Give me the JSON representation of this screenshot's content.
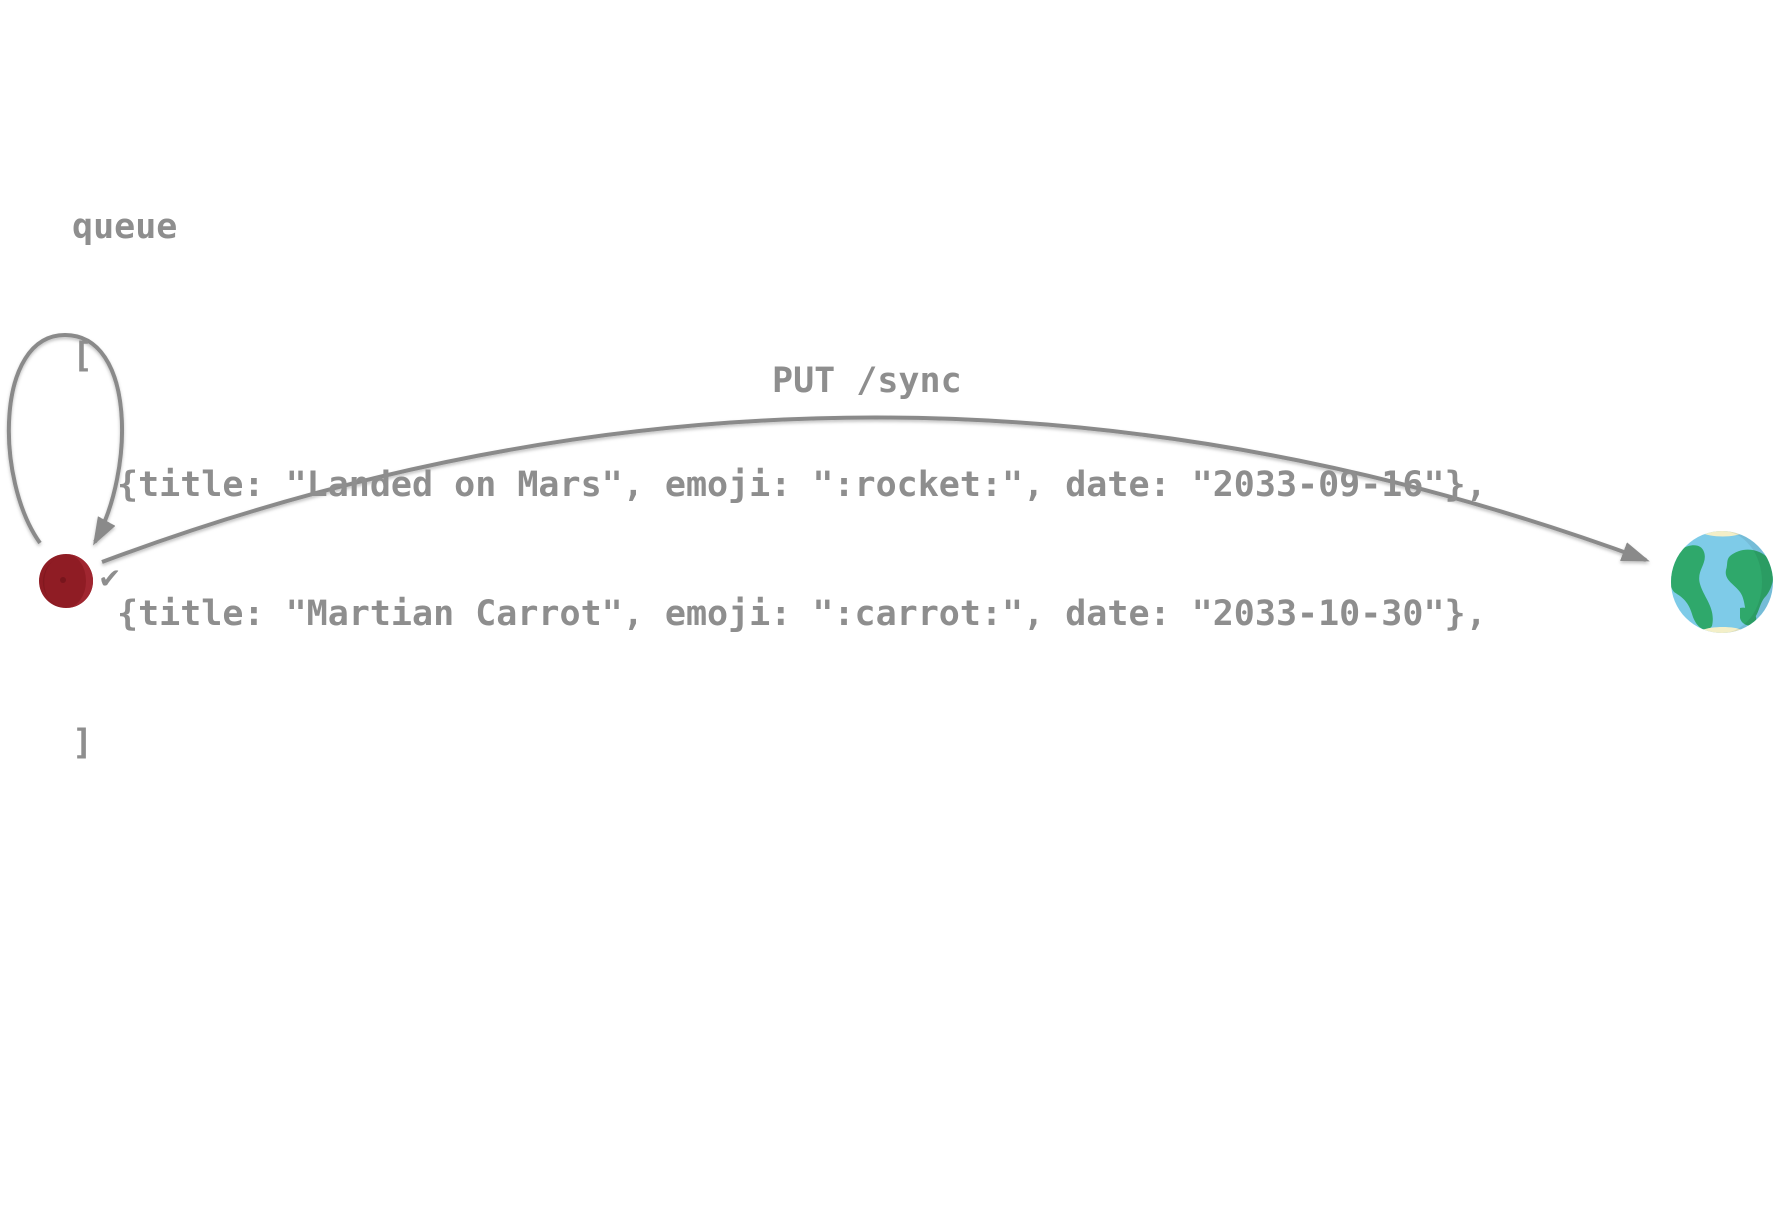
{
  "queue": {
    "label": "queue",
    "open_bracket": "[",
    "items": [
      "{title: \"Landed on Mars\", emoji: \":rocket:\", date: \"2033-09-16\"},",
      "{title: \"Martian Carrot\", emoji: \":carrot:\", date: \"2033-10-30\"},"
    ],
    "close_bracket": "]"
  },
  "edge": {
    "label": "PUT /sync"
  },
  "mars": {
    "status_mark": "✔",
    "icon": "mars-planet-icon",
    "color": "#8f1c24"
  },
  "earth": {
    "icon": "earth-globe-icon",
    "ocean_color": "#7ecbe8",
    "land_color": "#2fa86b"
  },
  "colors": {
    "text": "#8e8e8e",
    "arrow": "#8a8a8a"
  }
}
